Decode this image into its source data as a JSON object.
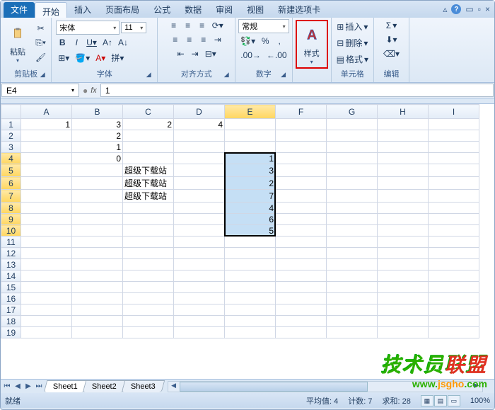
{
  "tabs": {
    "file": "文件",
    "items": [
      "开始",
      "插入",
      "页面布局",
      "公式",
      "数据",
      "审阅",
      "视图",
      "新建选项卡"
    ],
    "active": 0
  },
  "ribbon": {
    "clipboard": {
      "label": "剪贴板",
      "paste": "粘贴"
    },
    "font": {
      "label": "字体",
      "name": "宋体",
      "size": "11",
      "bold": "B",
      "italic": "I",
      "underline": "U"
    },
    "align": {
      "label": "对齐方式"
    },
    "number": {
      "label": "数字",
      "format": "常规",
      "percent": "%",
      "comma": ","
    },
    "styles": {
      "label": "样式"
    },
    "cells": {
      "label": "单元格",
      "insert": "插入",
      "delete": "删除",
      "format": "格式"
    },
    "editing": {
      "label": "编辑",
      "sigma": "Σ"
    }
  },
  "formula_bar": {
    "name_box": "E4",
    "fx": "fx",
    "value": "1"
  },
  "columns": [
    "A",
    "B",
    "C",
    "D",
    "E",
    "F",
    "G",
    "H",
    "I"
  ],
  "rows": [
    1,
    2,
    3,
    4,
    5,
    6,
    7,
    8,
    9,
    10,
    11,
    12,
    13,
    14,
    15,
    16,
    17,
    18,
    19
  ],
  "cells": {
    "A1": "1",
    "B1": "3",
    "C1": "2",
    "D1": "4",
    "B2": "2",
    "B3": "1",
    "B4": "0",
    "C5": "超级下载站",
    "C6": "超级下载站",
    "C7": "超级下载站",
    "E4": "1",
    "E5": "3",
    "E6": "2",
    "E7": "7",
    "E8": "4",
    "E9": "6",
    "E10": "5"
  },
  "selection": {
    "col": "E",
    "rows": [
      4,
      5,
      6,
      7,
      8,
      9,
      10
    ]
  },
  "sheets": {
    "items": [
      "Sheet1",
      "Sheet2",
      "Sheet3"
    ],
    "active": 0
  },
  "status": {
    "ready": "就绪",
    "avg_label": "平均值:",
    "avg": "4",
    "count_label": "计数:",
    "count": "7",
    "sum_label": "求和:",
    "sum": "28",
    "zoom": "100%"
  },
  "watermark": {
    "cn1": "技术员",
    "cn2": "联盟",
    "url1": "www.",
    "url2": "jsgho",
    "url3": ".com"
  }
}
